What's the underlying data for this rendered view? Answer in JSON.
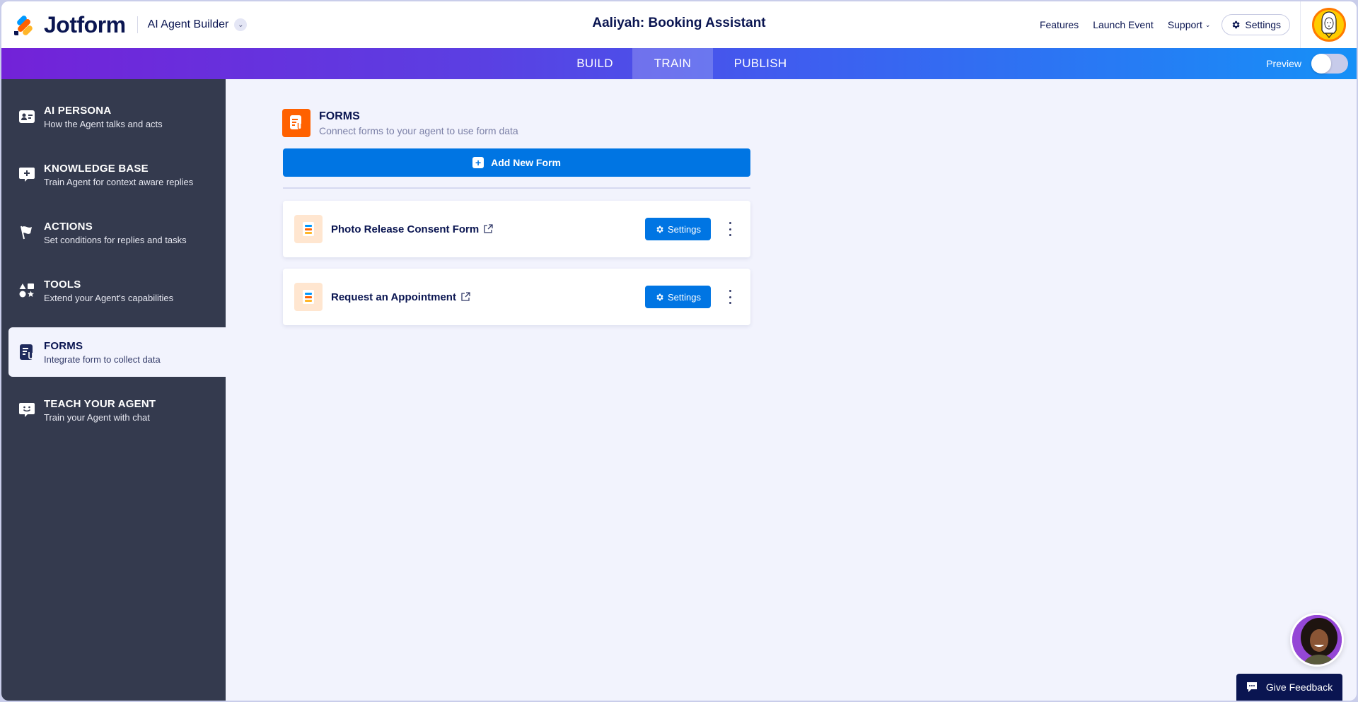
{
  "header": {
    "logo_text": "Jotform",
    "product_name": "AI Agent Builder",
    "agent_title": "Aaliyah: Booking Assistant",
    "links": [
      "Features",
      "Launch Event",
      "Support"
    ],
    "settings_label": "Settings"
  },
  "nav": {
    "tabs": [
      {
        "label": "BUILD",
        "active": false
      },
      {
        "label": "TRAIN",
        "active": true
      },
      {
        "label": "PUBLISH",
        "active": false
      }
    ],
    "preview_label": "Preview",
    "preview_enabled": false
  },
  "sidebar": {
    "items": [
      {
        "title": "AI PERSONA",
        "subtitle": "How the Agent talks and acts",
        "icon": "id-card-icon"
      },
      {
        "title": "KNOWLEDGE BASE",
        "subtitle": "Train Agent for context aware replies",
        "icon": "chat-plus-icon"
      },
      {
        "title": "ACTIONS",
        "subtitle": "Set conditions for replies and tasks",
        "icon": "flag-icon"
      },
      {
        "title": "TOOLS",
        "subtitle": "Extend your Agent's capabilities",
        "icon": "shapes-icon"
      },
      {
        "title": "FORMS",
        "subtitle": "Integrate form to collect data",
        "icon": "form-icon",
        "active": true
      },
      {
        "title": "TEACH YOUR AGENT",
        "subtitle": "Train your Agent with chat",
        "icon": "smile-chat-icon"
      }
    ]
  },
  "main": {
    "section_title": "FORMS",
    "section_subtitle": "Connect forms to your agent to use form data",
    "add_button_label": "Add New Form",
    "forms": [
      {
        "name": "Photo Release Consent Form",
        "settings_label": "Settings"
      },
      {
        "name": "Request an Appointment",
        "settings_label": "Settings"
      }
    ]
  },
  "feedback": {
    "label": "Give Feedback"
  },
  "colors": {
    "primary_blue": "#0075e3",
    "navy": "#0a1551",
    "orange": "#ff6100",
    "sidebar_bg": "#343a4e",
    "main_bg": "#f2f3fd"
  }
}
